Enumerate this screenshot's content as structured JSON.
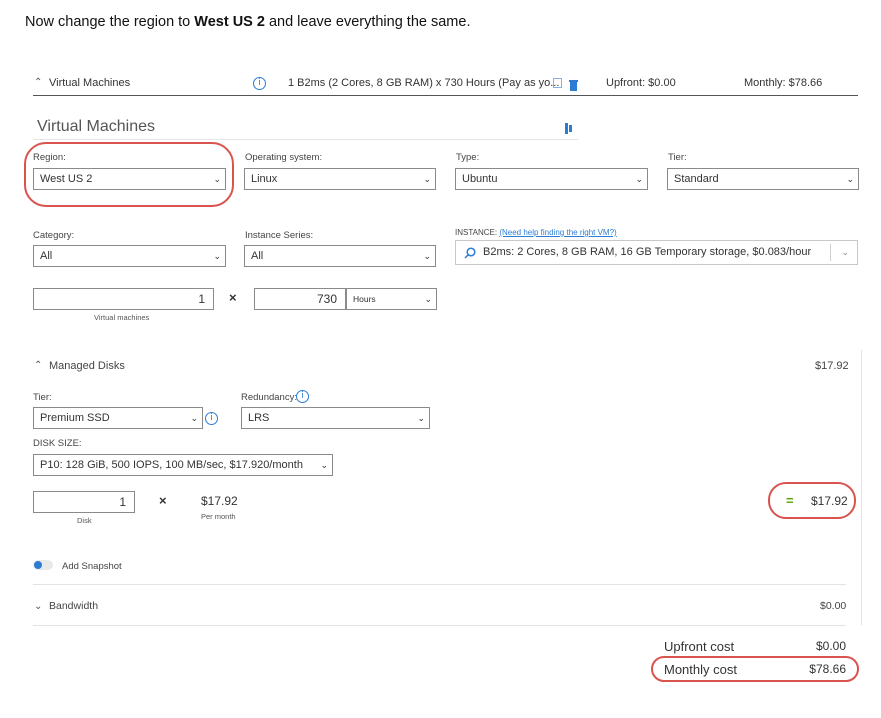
{
  "instruction": {
    "prefix": "Now change the region to ",
    "bold": "West US 2",
    "suffix": " and leave everything the same."
  },
  "header": {
    "section_name": "Virtual Machines",
    "summary": "1 B2ms (2 Cores, 8 GB RAM) x 730 Hours (Pay as yo...",
    "upfront": "Upfront: $0.00",
    "monthly": "Monthly: $78.66"
  },
  "vm": {
    "title": "Virtual Machines",
    "region": {
      "label": "Region:",
      "value": "West US 2"
    },
    "os": {
      "label": "Operating system:",
      "value": "Linux"
    },
    "type": {
      "label": "Type:",
      "value": "Ubuntu"
    },
    "tier": {
      "label": "Tier:",
      "value": "Standard"
    },
    "category": {
      "label": "Category:",
      "value": "All"
    },
    "series": {
      "label": "Instance Series:",
      "value": "All"
    },
    "instance": {
      "label_prefix": "INSTANCE: ",
      "help_link": "(Need help finding the right VM?)",
      "value": "B2ms: 2 Cores, 8 GB RAM, 16 GB Temporary storage, $0.083/hour"
    },
    "count": {
      "value": "1",
      "caption": "Virtual machines"
    },
    "hours": {
      "value": "730",
      "unit": "Hours"
    }
  },
  "disks": {
    "title": "Managed Disks",
    "total": "$17.92",
    "tier": {
      "label": "Tier:",
      "value": "Premium SSD"
    },
    "redundancy": {
      "label": "Redundancy:",
      "value": "LRS"
    },
    "disk_size": {
      "label": "DISK SIZE:",
      "value": "P10: 128 GiB, 500 IOPS, 100 MB/sec, $17.920/month"
    },
    "count": {
      "value": "1",
      "caption": "Disk"
    },
    "per_month": {
      "value": "$17.92",
      "caption": "Per month"
    },
    "equals_total": "$17.92",
    "snapshot_label": "Add Snapshot"
  },
  "bandwidth": {
    "title": "Bandwidth",
    "total": "$0.00"
  },
  "costs": {
    "upfront_label": "Upfront cost",
    "upfront_value": "$0.00",
    "monthly_label": "Monthly cost",
    "monthly_value": "$78.66"
  },
  "colors": {
    "accent": "#2b7cd3",
    "highlight": "#d9534f",
    "equals": "#57a300"
  }
}
